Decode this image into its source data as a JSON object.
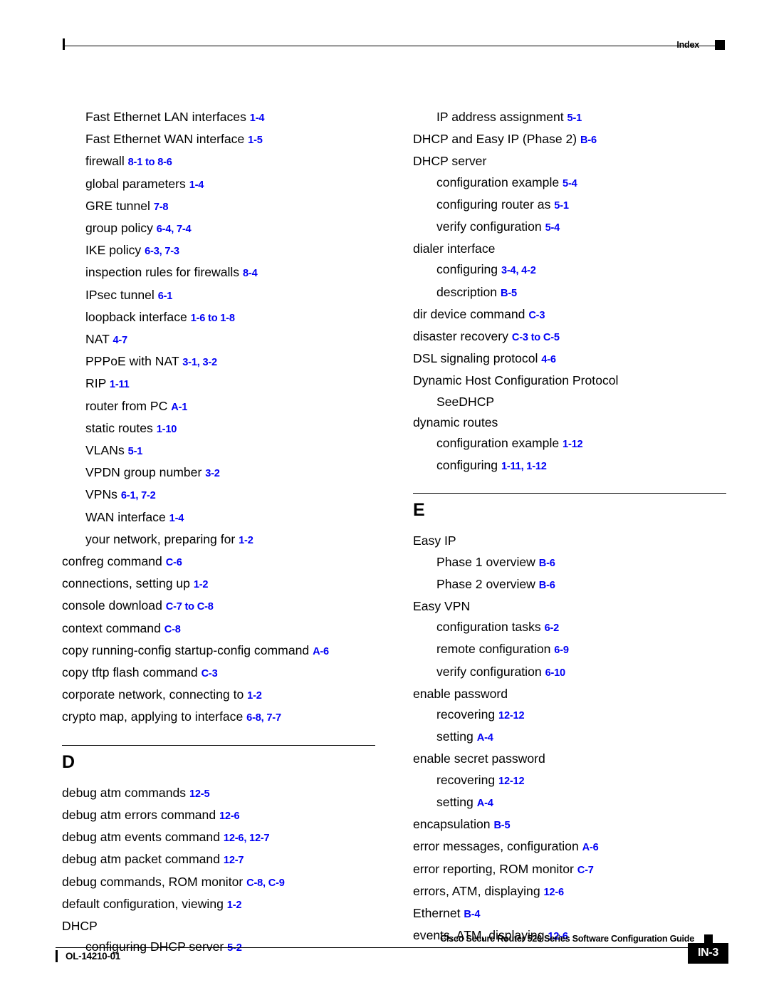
{
  "header": {
    "title": "Index"
  },
  "footer": {
    "guide_title": "Cisco Secure Router 520 Series Software Configuration Guide",
    "doc_id": "OL-14210-01",
    "page_number": "IN-3"
  },
  "columns": {
    "left": {
      "entries": [
        {
          "level": 2,
          "term": "Fast Ethernet LAN interfaces",
          "locs": "1-4"
        },
        {
          "level": 2,
          "term": "Fast Ethernet WAN interface",
          "locs": "1-5"
        },
        {
          "level": 2,
          "term": "firewall",
          "locs": "8-1 to 8-6"
        },
        {
          "level": 2,
          "term": "global parameters",
          "locs": "1-4"
        },
        {
          "level": 2,
          "term": "GRE tunnel",
          "locs": "7-8"
        },
        {
          "level": 2,
          "term": "group policy",
          "locs": "6-4, 7-4"
        },
        {
          "level": 2,
          "term": "IKE policy",
          "locs": "6-3, 7-3"
        },
        {
          "level": 2,
          "term": "inspection rules for firewalls",
          "locs": "8-4"
        },
        {
          "level": 2,
          "term": "IPsec tunnel",
          "locs": "6-1"
        },
        {
          "level": 2,
          "term": "loopback interface",
          "locs": "1-6 to 1-8"
        },
        {
          "level": 2,
          "term": "NAT",
          "locs": "4-7"
        },
        {
          "level": 2,
          "term": "PPPoE with NAT",
          "locs": "3-1, 3-2"
        },
        {
          "level": 2,
          "term": "RIP",
          "locs": "1-11"
        },
        {
          "level": 2,
          "term": "router from PC",
          "locs": "A-1"
        },
        {
          "level": 2,
          "term": "static routes",
          "locs": "1-10"
        },
        {
          "level": 2,
          "term": "VLANs",
          "locs": "5-1"
        },
        {
          "level": 2,
          "term": "VPDN group number",
          "locs": "3-2"
        },
        {
          "level": 2,
          "term": "VPNs",
          "locs": "6-1, 7-2"
        },
        {
          "level": 2,
          "term": "WAN interface",
          "locs": "1-4"
        },
        {
          "level": 2,
          "term": "your network, preparing for",
          "locs": "1-2"
        },
        {
          "level": 1,
          "term": "confreg command",
          "locs": "C-6"
        },
        {
          "level": 1,
          "term": "connections, setting up",
          "locs": "1-2"
        },
        {
          "level": 1,
          "term": "console download",
          "locs": "C-7 to C-8"
        },
        {
          "level": 1,
          "term": "context command",
          "locs": "C-8"
        },
        {
          "level": 1,
          "term": "copy running-config startup-config command",
          "locs": "A-6"
        },
        {
          "level": 1,
          "term": "copy tftp flash command",
          "locs": "C-3"
        },
        {
          "level": 1,
          "term": "corporate network, connecting to",
          "locs": "1-2"
        },
        {
          "level": 1,
          "term": "crypto map, applying to interface",
          "locs": "6-8, 7-7"
        }
      ],
      "section": {
        "letter": "D",
        "entries": [
          {
            "level": 1,
            "term": "debug atm commands",
            "locs": "12-5"
          },
          {
            "level": 1,
            "term": "debug atm errors command",
            "locs": "12-6"
          },
          {
            "level": 1,
            "term": "debug atm events command",
            "locs": "12-6, 12-7"
          },
          {
            "level": 1,
            "term": "debug atm packet command",
            "locs": "12-7"
          },
          {
            "level": 1,
            "term": "debug commands, ROM monitor",
            "locs": "C-8, C-9"
          },
          {
            "level": 1,
            "term": "default configuration, viewing",
            "locs": "1-2"
          },
          {
            "level": 1,
            "term": "DHCP",
            "locs": ""
          },
          {
            "level": 2,
            "term": "configuring DHCP server",
            "locs": "5-2"
          }
        ]
      }
    },
    "right": {
      "entries": [
        {
          "level": 2,
          "term": "IP address assignment",
          "locs": "5-1"
        },
        {
          "level": 1,
          "term": "DHCP and Easy IP (Phase 2)",
          "locs": "B-6"
        },
        {
          "level": 1,
          "term": "DHCP server",
          "locs": ""
        },
        {
          "level": 2,
          "term": "configuration example",
          "locs": "5-4"
        },
        {
          "level": 2,
          "term": "configuring router as",
          "locs": "5-1"
        },
        {
          "level": 2,
          "term": "verify configuration",
          "locs": "5-4"
        },
        {
          "level": 1,
          "term": "dialer interface",
          "locs": ""
        },
        {
          "level": 2,
          "term": "configuring",
          "locs": "3-4, 4-2"
        },
        {
          "level": 2,
          "term": "description",
          "locs": "B-5"
        },
        {
          "level": 1,
          "term": "dir device command",
          "locs": "C-3"
        },
        {
          "level": 1,
          "term": "disaster recovery",
          "locs": "C-3 to C-5"
        },
        {
          "level": 1,
          "term": "DSL signaling protocol",
          "locs": "4-6"
        },
        {
          "level": 1,
          "term": "Dynamic Host Configuration Protocol",
          "locs": ""
        },
        {
          "level": 2,
          "term": "SeeDHCP",
          "locs": ""
        },
        {
          "level": 1,
          "term": "dynamic routes",
          "locs": ""
        },
        {
          "level": 2,
          "term": "configuration example",
          "locs": "1-12"
        },
        {
          "level": 2,
          "term": "configuring",
          "locs": "1-11, 1-12"
        }
      ],
      "section": {
        "letter": "E",
        "entries": [
          {
            "level": 1,
            "term": "Easy IP",
            "locs": ""
          },
          {
            "level": 2,
            "term": "Phase 1 overview",
            "locs": "B-6"
          },
          {
            "level": 2,
            "term": "Phase 2 overview",
            "locs": "B-6"
          },
          {
            "level": 1,
            "term": "Easy VPN",
            "locs": ""
          },
          {
            "level": 2,
            "term": "configuration tasks",
            "locs": "6-2"
          },
          {
            "level": 2,
            "term": "remote configuration",
            "locs": "6-9"
          },
          {
            "level": 2,
            "term": "verify configuration",
            "locs": "6-10"
          },
          {
            "level": 1,
            "term": "enable password",
            "locs": ""
          },
          {
            "level": 2,
            "term": "recovering",
            "locs": "12-12"
          },
          {
            "level": 2,
            "term": "setting",
            "locs": "A-4"
          },
          {
            "level": 1,
            "term": "enable secret password",
            "locs": ""
          },
          {
            "level": 2,
            "term": "recovering",
            "locs": "12-12"
          },
          {
            "level": 2,
            "term": "setting",
            "locs": "A-4"
          },
          {
            "level": 1,
            "term": "encapsulation",
            "locs": "B-5"
          },
          {
            "level": 1,
            "term": "error messages, configuration",
            "locs": "A-6"
          },
          {
            "level": 1,
            "term": "error reporting, ROM monitor",
            "locs": "C-7"
          },
          {
            "level": 1,
            "term": "errors, ATM, displaying",
            "locs": "12-6"
          },
          {
            "level": 1,
            "term": "Ethernet",
            "locs": "B-4"
          },
          {
            "level": 1,
            "term": "events, ATM, displaying",
            "locs": "12-6"
          }
        ]
      }
    }
  }
}
